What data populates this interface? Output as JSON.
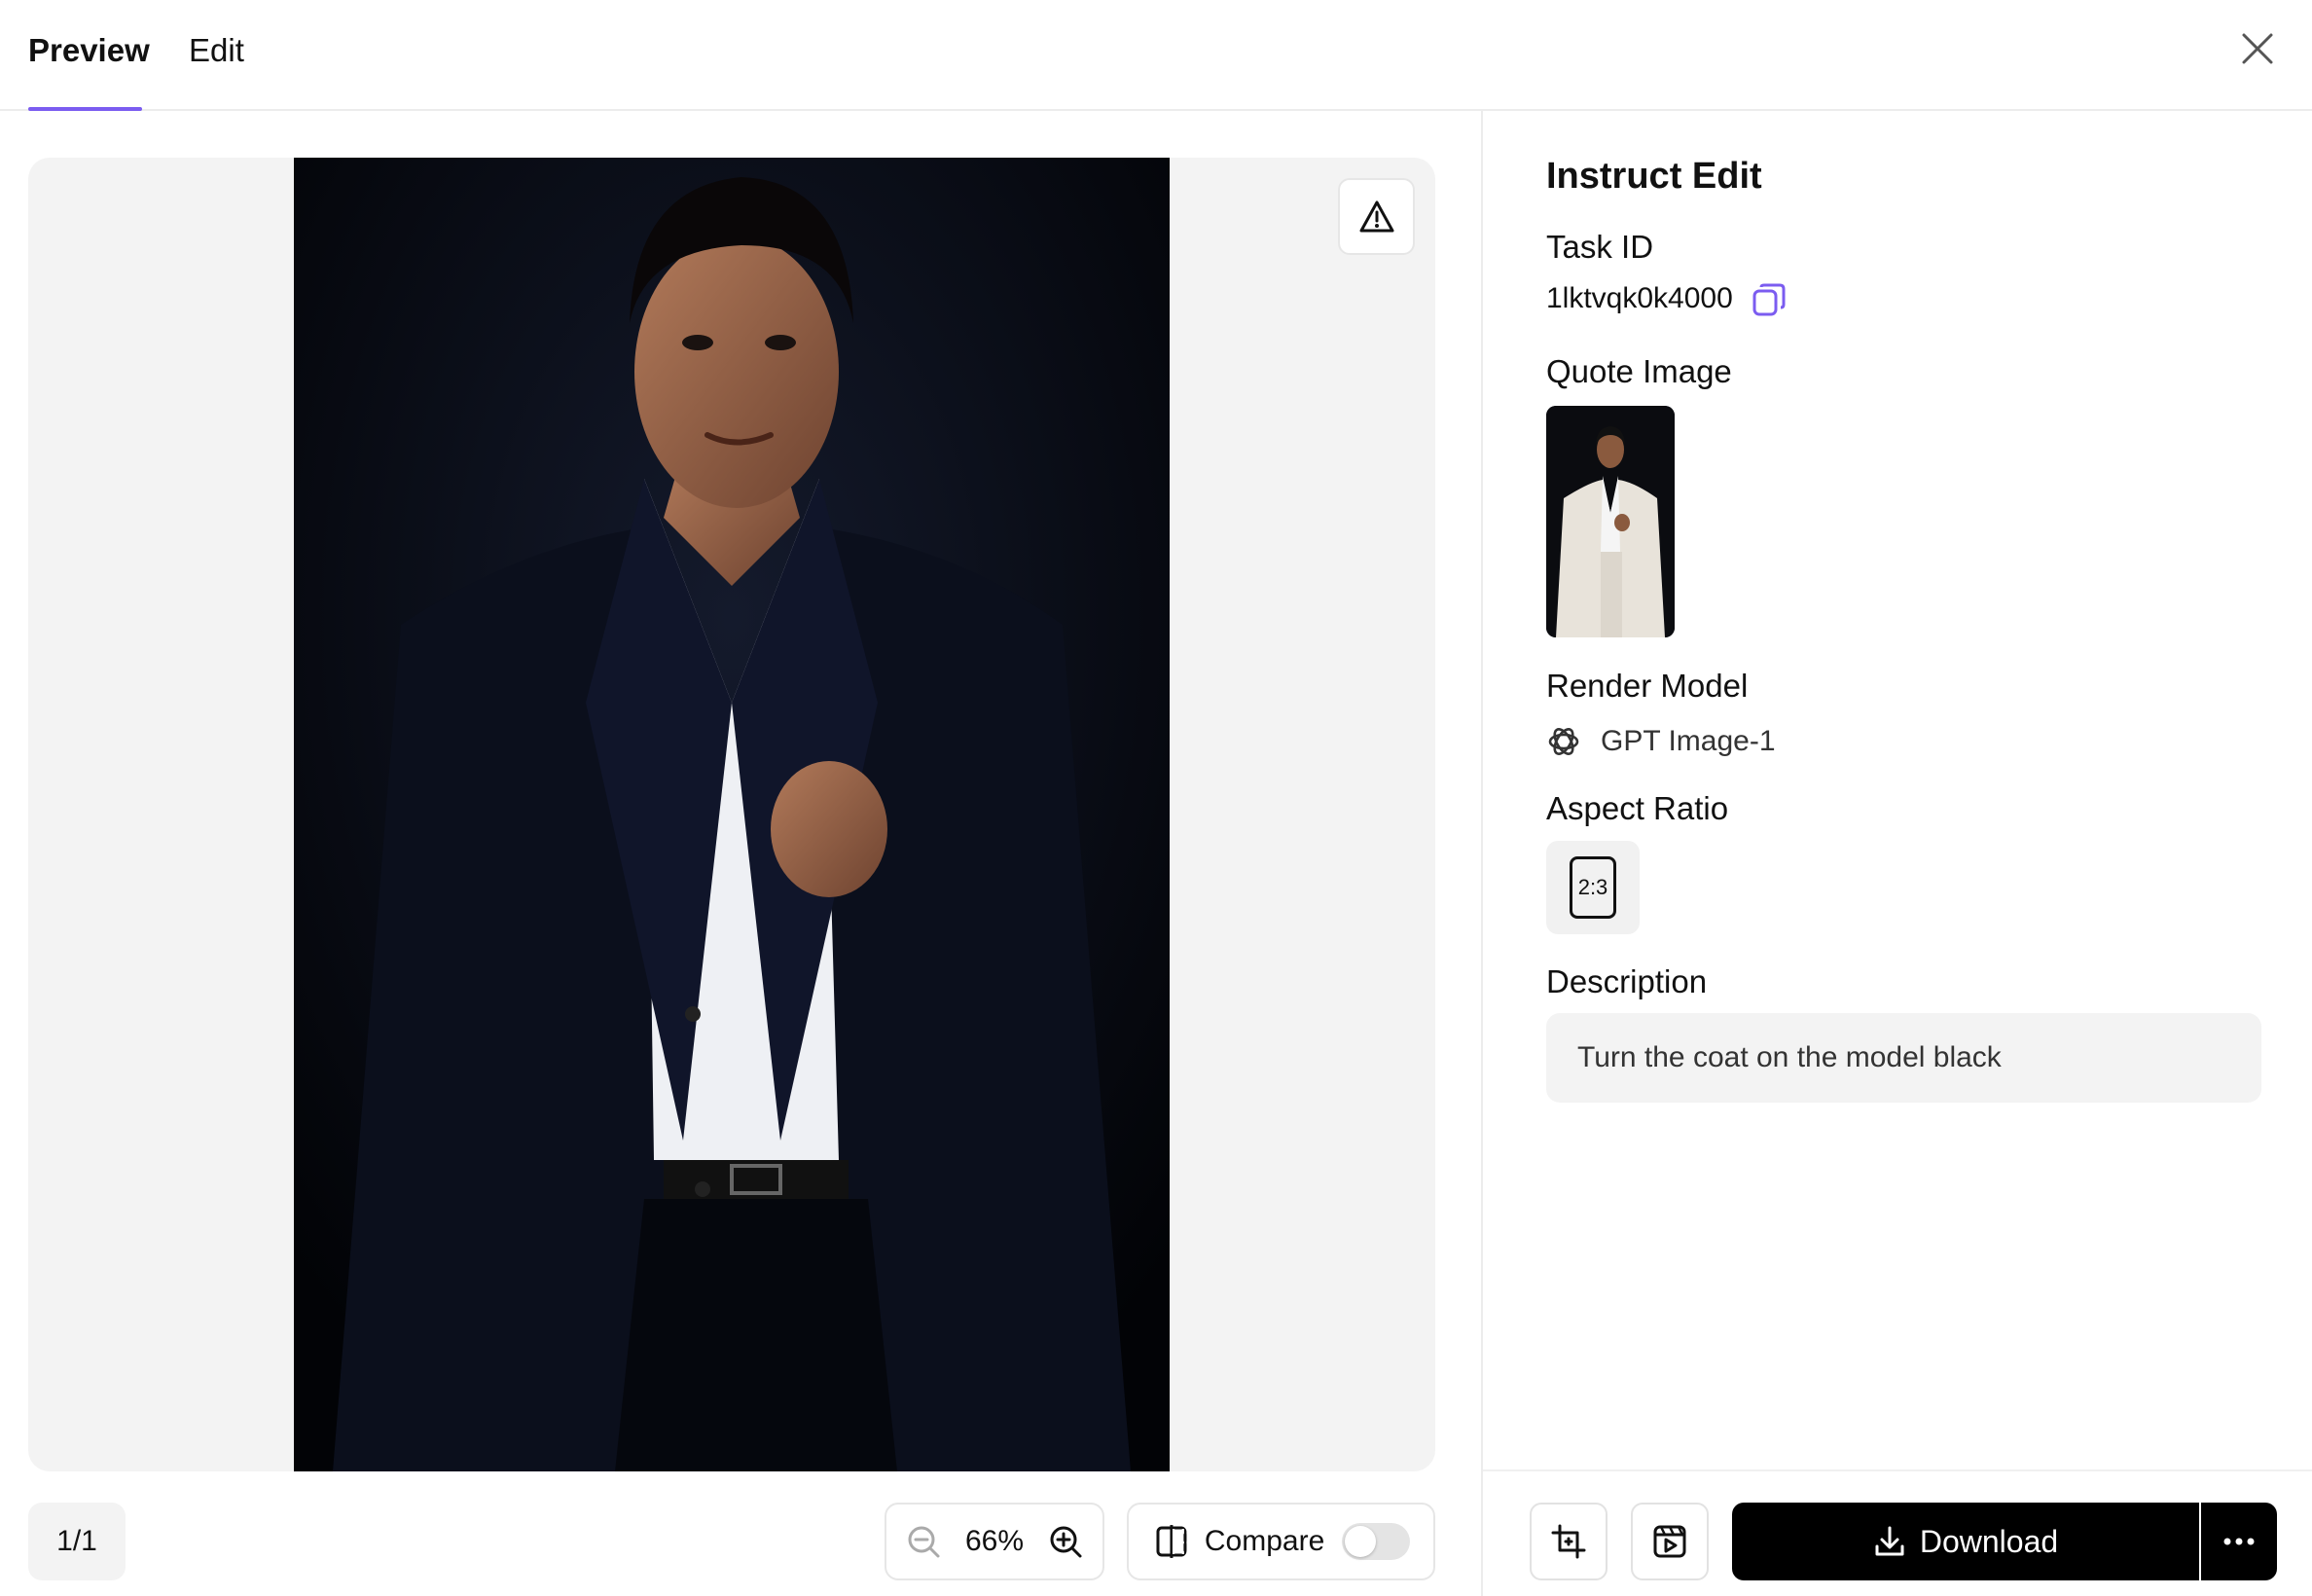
{
  "tabs": [
    {
      "label": "Preview",
      "active": true
    },
    {
      "label": "Edit",
      "active": false
    }
  ],
  "accent_color": "#7b5cf0",
  "preview": {
    "page_indicator": "1/1",
    "zoom": "66%",
    "compare_label": "Compare",
    "compare_enabled": false
  },
  "panel": {
    "title": "Instruct Edit",
    "task_id_label": "Task ID",
    "task_id": "1lktvqk0k4000",
    "quote_image_label": "Quote Image",
    "render_model_label": "Render Model",
    "render_model": "GPT Image-1",
    "aspect_ratio_label": "Aspect Ratio",
    "aspect_ratio": "2:3",
    "description_label": "Description",
    "description": "Turn the coat on the model black"
  },
  "actions": {
    "download_label": "Download"
  },
  "icons": [
    "close-icon",
    "warning-icon",
    "zoom-out-icon",
    "zoom-in-icon",
    "compare-icon",
    "copy-icon",
    "openai-icon",
    "crop-icon",
    "video-icon",
    "download-icon",
    "more-icon"
  ]
}
